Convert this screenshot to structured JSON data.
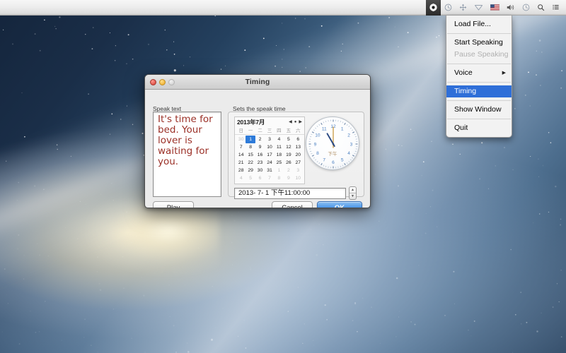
{
  "menubar": {
    "icons": [
      {
        "name": "speaker-app-icon",
        "glyph": "speaker-app",
        "active": true
      },
      {
        "name": "clock-icon",
        "glyph": "clock",
        "active": false
      },
      {
        "name": "move-arrows-icon",
        "glyph": "arrows",
        "active": false
      },
      {
        "name": "airplay-icon",
        "glyph": "diamond",
        "active": false
      },
      {
        "name": "flag-icon",
        "glyph": "flag",
        "active": false
      },
      {
        "name": "volume-icon",
        "glyph": "volume",
        "active": false
      },
      {
        "name": "time-machine-icon",
        "glyph": "timemachine",
        "active": false
      },
      {
        "name": "spotlight-search-icon",
        "glyph": "search",
        "active": false
      },
      {
        "name": "notification-center-icon",
        "glyph": "list",
        "active": false
      }
    ]
  },
  "appmenu": {
    "items": [
      {
        "label": "Load File...",
        "state": "normal",
        "submenu": false
      },
      {
        "label": "Start Speaking",
        "state": "normal",
        "submenu": false
      },
      {
        "label": "Pause Speaking",
        "state": "disabled",
        "submenu": false
      },
      {
        "label": "Voice",
        "state": "normal",
        "submenu": true
      },
      {
        "label": "Timing",
        "state": "selected",
        "submenu": false
      },
      {
        "label": "Show Window",
        "state": "normal",
        "submenu": false
      },
      {
        "label": "Quit",
        "state": "normal",
        "submenu": false
      }
    ],
    "submenu_arrow": "▶",
    "highlight_color": "#2f6fd8"
  },
  "dialog": {
    "title": "Timing",
    "speak_group_label": "Speak text",
    "speak_text": "It's time for bed. Your lover is waiting for you.",
    "speak_text_color": "#9b3027",
    "time_group_label": "Sets the speak time",
    "calendar": {
      "month_title": "2013年7月",
      "nav_prev": "◀",
      "nav_today": "●",
      "nav_next": "▶",
      "weekdays": [
        "日",
        "一",
        "二",
        "三",
        "四",
        "五",
        "六"
      ],
      "selected_day": 1,
      "weeks": [
        [
          {
            "d": "30",
            "out": true
          },
          {
            "d": "1",
            "out": false,
            "sel": true
          },
          {
            "d": "2",
            "out": false
          },
          {
            "d": "3",
            "out": false
          },
          {
            "d": "4",
            "out": false
          },
          {
            "d": "5",
            "out": false
          },
          {
            "d": "6",
            "out": false
          }
        ],
        [
          {
            "d": "7",
            "out": false
          },
          {
            "d": "8",
            "out": false
          },
          {
            "d": "9",
            "out": false
          },
          {
            "d": "10",
            "out": false
          },
          {
            "d": "11",
            "out": false
          },
          {
            "d": "12",
            "out": false
          },
          {
            "d": "13",
            "out": false
          }
        ],
        [
          {
            "d": "14",
            "out": false
          },
          {
            "d": "15",
            "out": false
          },
          {
            "d": "16",
            "out": false
          },
          {
            "d": "17",
            "out": false
          },
          {
            "d": "18",
            "out": false
          },
          {
            "d": "19",
            "out": false
          },
          {
            "d": "20",
            "out": false
          }
        ],
        [
          {
            "d": "21",
            "out": false
          },
          {
            "d": "22",
            "out": false
          },
          {
            "d": "23",
            "out": false
          },
          {
            "d": "24",
            "out": false
          },
          {
            "d": "25",
            "out": false
          },
          {
            "d": "26",
            "out": false
          },
          {
            "d": "27",
            "out": false
          }
        ],
        [
          {
            "d": "28",
            "out": false
          },
          {
            "d": "29",
            "out": false
          },
          {
            "d": "30",
            "out": false
          },
          {
            "d": "31",
            "out": false
          },
          {
            "d": "1",
            "out": true
          },
          {
            "d": "2",
            "out": true
          },
          {
            "d": "3",
            "out": true
          }
        ],
        [
          {
            "d": "4",
            "out": true
          },
          {
            "d": "5",
            "out": true
          },
          {
            "d": "6",
            "out": true
          },
          {
            "d": "7",
            "out": true
          },
          {
            "d": "8",
            "out": true
          },
          {
            "d": "9",
            "out": true
          },
          {
            "d": "10",
            "out": true
          }
        ]
      ]
    },
    "clock": {
      "hour_numerals": [
        "12",
        "1",
        "2",
        "3",
        "4",
        "5",
        "6",
        "7",
        "8",
        "9",
        "10",
        "11"
      ],
      "ampm_label": "下午",
      "hour": 11,
      "minute": 0,
      "numeral_color": "#4a7fc1"
    },
    "date_field_value": "2013- 7- 1 下午11:00:00",
    "stepper_up": "▲",
    "stepper_down": "▼",
    "buttons": {
      "play": "Play",
      "cancel": "Cancel",
      "ok": "OK",
      "default_color": "#4c97e8"
    }
  }
}
